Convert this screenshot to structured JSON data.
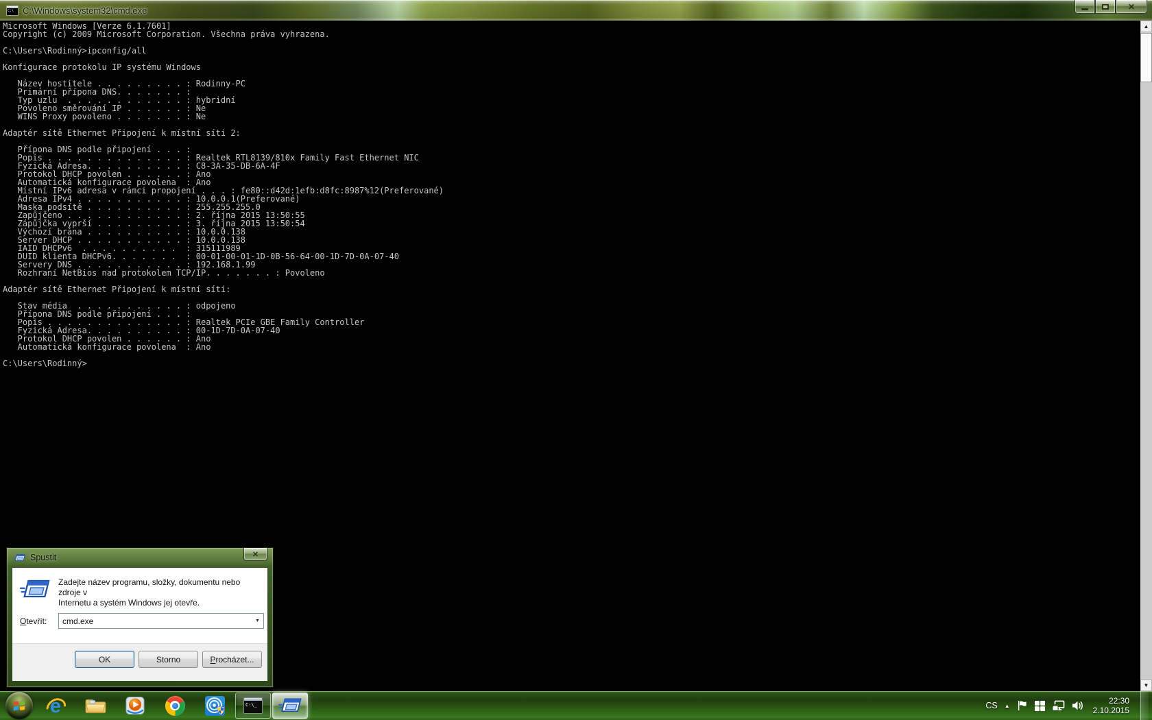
{
  "cmd_window": {
    "title": "C:\\Windows\\system32\\cmd.exe",
    "console_lines": [
      "Microsoft Windows [Verze 6.1.7601]",
      "Copyright (c) 2009 Microsoft Corporation. Všechna práva vyhrazena.",
      "",
      "C:\\Users\\Rodinný>ipconfig/all",
      "",
      "Konfigurace protokolu IP systému Windows",
      "",
      "   Název hostitele . . . . . . . . . : Rodinny-PC",
      "   Primární přípona DNS. . . . . . . :",
      "   Typ uzlu  . . . . . . . . . . . . : hybridní",
      "   Povoleno směrování IP . . . . . . : Ne",
      "   WINS Proxy povoleno . . . . . . . : Ne",
      "",
      "Adaptér sítě Ethernet Připojení k místní síti 2:",
      "",
      "   Přípona DNS podle připojení . . . :",
      "   Popis . . . . . . . . . . . . . . : Realtek RTL8139/810x Family Fast Ethernet NIC",
      "   Fyzická Adresa. . . . . . . . . . : C8-3A-35-DB-6A-4F",
      "   Protokol DHCP povolen . . . . . . : Ano",
      "   Automatická konfigurace povolena  : Ano",
      "   Místní IPv6 adresa v rámci propojení . . . : fe80::d42d:1efb:d8fc:8987%12(Preferované)",
      "   Adresa IPv4 . . . . . . . . . . . : 10.0.0.1(Preferované)",
      "   Maska podsítě . . . . . . . . . . : 255.255.255.0",
      "   Zapůjčeno . . . . . . . . . . . . : 2. října 2015 13:50:55",
      "   Zápůjčka vyprší . . . . . . . . . : 3. října 2015 13:50:54",
      "   Výchozí brána . . . . . . . . . . : 10.0.0.138",
      "   Server DHCP . . . . . . . . . . . : 10.0.0.138",
      "   IAID DHCPv6  . . . . . . . . . .  : 315111989",
      "   DUID klienta DHCPv6. . . . . . .  : 00-01-00-01-1D-0B-56-64-00-1D-7D-0A-07-40",
      "   Servery DNS . . . . . . . . . . . : 192.168.1.99",
      "   Rozhraní NetBios nad protokolem TCP/IP. . . . . . . : Povoleno",
      "",
      "Adaptér sítě Ethernet Připojení k místní síti:",
      "",
      "   Stav média  . . . . . . . . . . . : odpojeno",
      "   Přípona DNS podle připojení . . . :",
      "   Popis . . . . . . . . . . . . . . : Realtek PCIe GBE Family Controller",
      "   Fyzická Adresa. . . . . . . . . . : 00-1D-7D-0A-07-40",
      "   Protokol DHCP povolen . . . . . . : Ano",
      "   Automatická konfigurace povolena  : Ano",
      "",
      "C:\\Users\\Rodinný>"
    ]
  },
  "run_dialog": {
    "title": "Spustit",
    "message_lines": [
      "Zadejte název programu, složky, dokumentu nebo zdroje v",
      "Internetu a systém Windows jej otevře."
    ],
    "open_label_accel": "O",
    "open_label_rest": "tevřít:",
    "open_value": "cmd.exe",
    "ok_label": "OK",
    "cancel_label": "Storno",
    "browse_label_accel": "P",
    "browse_label_rest": "rocházet..."
  },
  "taskbar": {
    "tray": {
      "language_indicator": "CS",
      "clock_time": "22:30",
      "clock_date": "2.10.2015"
    }
  },
  "glyphs": {
    "close_x": "✕",
    "scroll_up": "▲",
    "scroll_down": "▼",
    "hidden_icons": "▲",
    "combo_arrow": "▼",
    "cmd_icon_text": "C:\\_",
    "cmd_mini_text": "C:\\"
  },
  "colors": {
    "console_text": "#c6c6c6",
    "console_background": "#000000",
    "taskbar_green": "#27520f",
    "dialog_frame_green": "#36511f",
    "titlebar_olive": "#7b8c3b"
  }
}
